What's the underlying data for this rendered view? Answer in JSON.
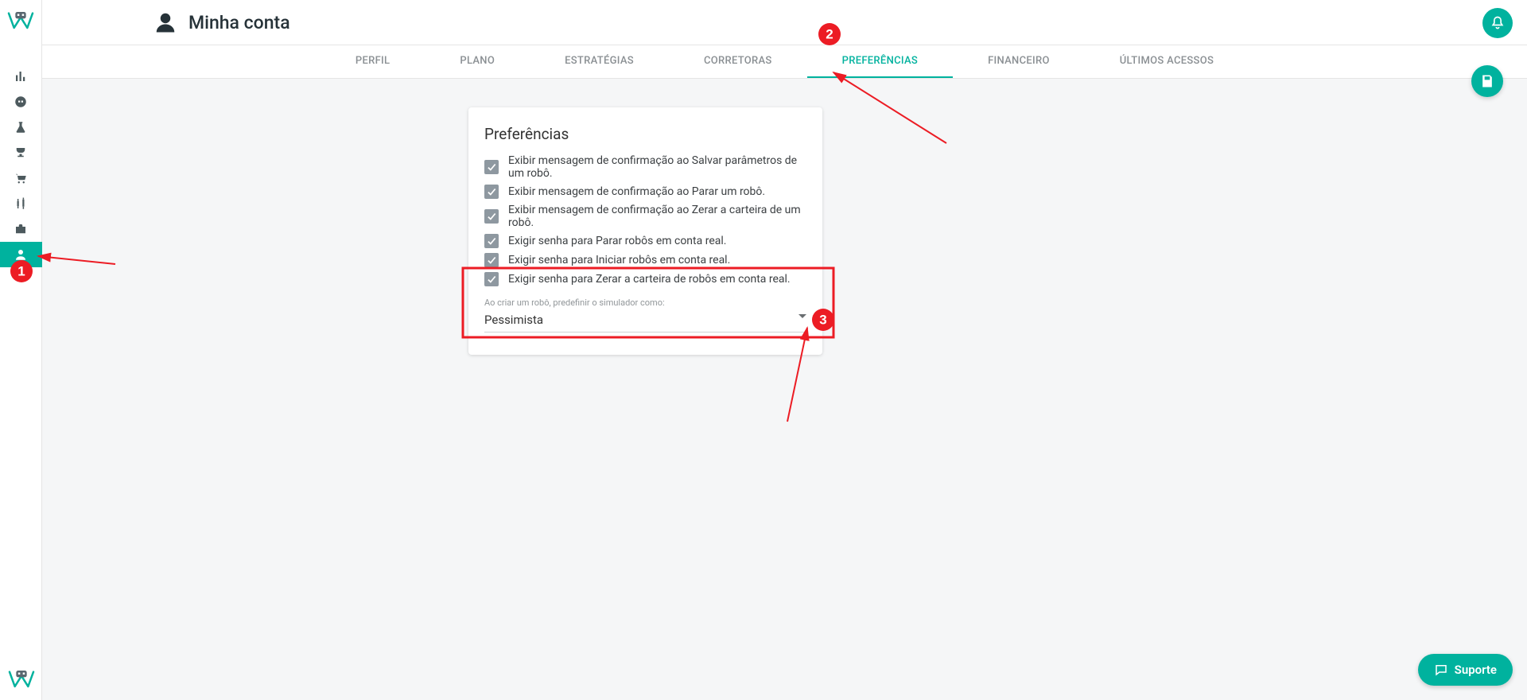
{
  "header": {
    "title": "Minha conta"
  },
  "tabs": [
    {
      "label": "PERFIL"
    },
    {
      "label": "PLANO"
    },
    {
      "label": "ESTRATÉGIAS"
    },
    {
      "label": "CORRETORAS"
    },
    {
      "label": "PREFERÊNCIAS",
      "active": true
    },
    {
      "label": "FINANCEIRO"
    },
    {
      "label": "ÚLTIMOS ACESSOS"
    }
  ],
  "card": {
    "title": "Preferências",
    "options": [
      "Exibir mensagem de confirmação ao Salvar parâmetros de um robô.",
      "Exibir mensagem de confirmação ao Parar um robô.",
      "Exibir mensagem de confirmação ao Zerar a carteira de um robô.",
      "Exigir senha para Parar robôs em conta real.",
      "Exigir senha para Iniciar robôs em conta real.",
      "Exigir senha para Zerar a carteira de robôs em conta real."
    ],
    "select_label": "Ao criar um robô, predefinir o simulador como:",
    "select_value": "Pessimista"
  },
  "support": {
    "label": "Suporte"
  },
  "annotations": {
    "b1": "1",
    "b2": "2",
    "b3": "3"
  },
  "sidebar_icons": [
    "dashboard-icon",
    "robot-icon",
    "flask-icon",
    "trophy-icon",
    "cart-icon",
    "candlestick-icon",
    "briefcase-icon",
    "account-icon"
  ],
  "colors": {
    "accent": "#00b29e",
    "annotation": "#ec1c24"
  }
}
